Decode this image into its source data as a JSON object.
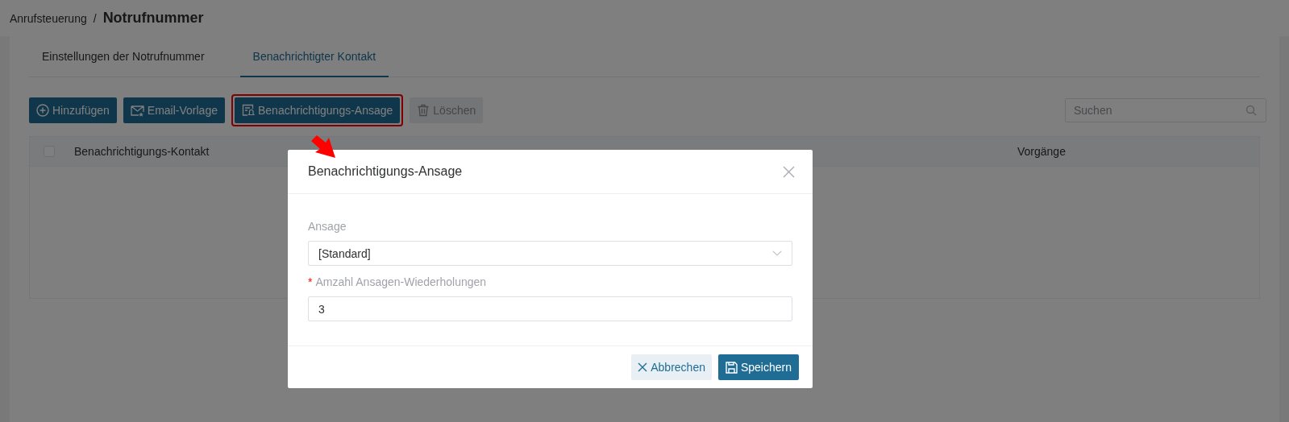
{
  "breadcrumb": {
    "parent": "Anrufsteuerung",
    "separator": "/",
    "current": "Notrufnummer"
  },
  "tabs": [
    {
      "label": "Einstellungen der Notrufnummer",
      "selected": false
    },
    {
      "label": "Benachrichtigter Kontakt",
      "selected": true
    }
  ],
  "toolbar": [
    {
      "label": "Hinzufügen",
      "kind": "add",
      "disabled": false,
      "highlighted": false
    },
    {
      "label": "Email-Vorlage",
      "kind": "mail",
      "disabled": false,
      "highlighted": false
    },
    {
      "label": "Benachrichtigungs-Ansage",
      "kind": "announce",
      "disabled": false,
      "highlighted": true
    },
    {
      "label": "Löschen",
      "kind": "delete",
      "disabled": true,
      "highlighted": false
    }
  ],
  "search": {
    "placeholder": "Suchen"
  },
  "table": {
    "select_all_checked": false,
    "columns": [
      "Benachrichtigungs-Kontakt",
      "Vorgänge"
    ]
  },
  "dialog": {
    "title": "Benachrichtigungs-Ansage",
    "fields": [
      {
        "kind": "select",
        "label": "Ansage",
        "value": "[Standard]"
      },
      {
        "kind": "input",
        "required_mark": "*",
        "label": "Amzahl Ansagen-Wiederholungen",
        "value": "3"
      }
    ],
    "buttons": [
      {
        "kind": "cancel",
        "label": "Abbrechen"
      },
      {
        "kind": "save",
        "label": "Speichern"
      }
    ]
  }
}
